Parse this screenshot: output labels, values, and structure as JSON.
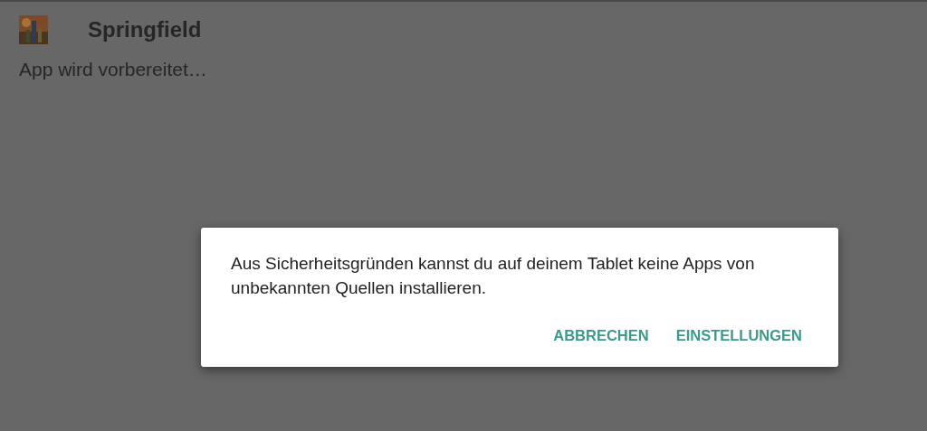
{
  "app": {
    "title": "Springfield",
    "status": "App wird vorbereitet…"
  },
  "dialog": {
    "message": "Aus Sicherheitsgründen kannst du auf deinem Tablet keine Apps von unbekannten Quellen installieren.",
    "buttons": [
      "ABBRECHEN",
      "EINSTELLUNGEN"
    ]
  }
}
